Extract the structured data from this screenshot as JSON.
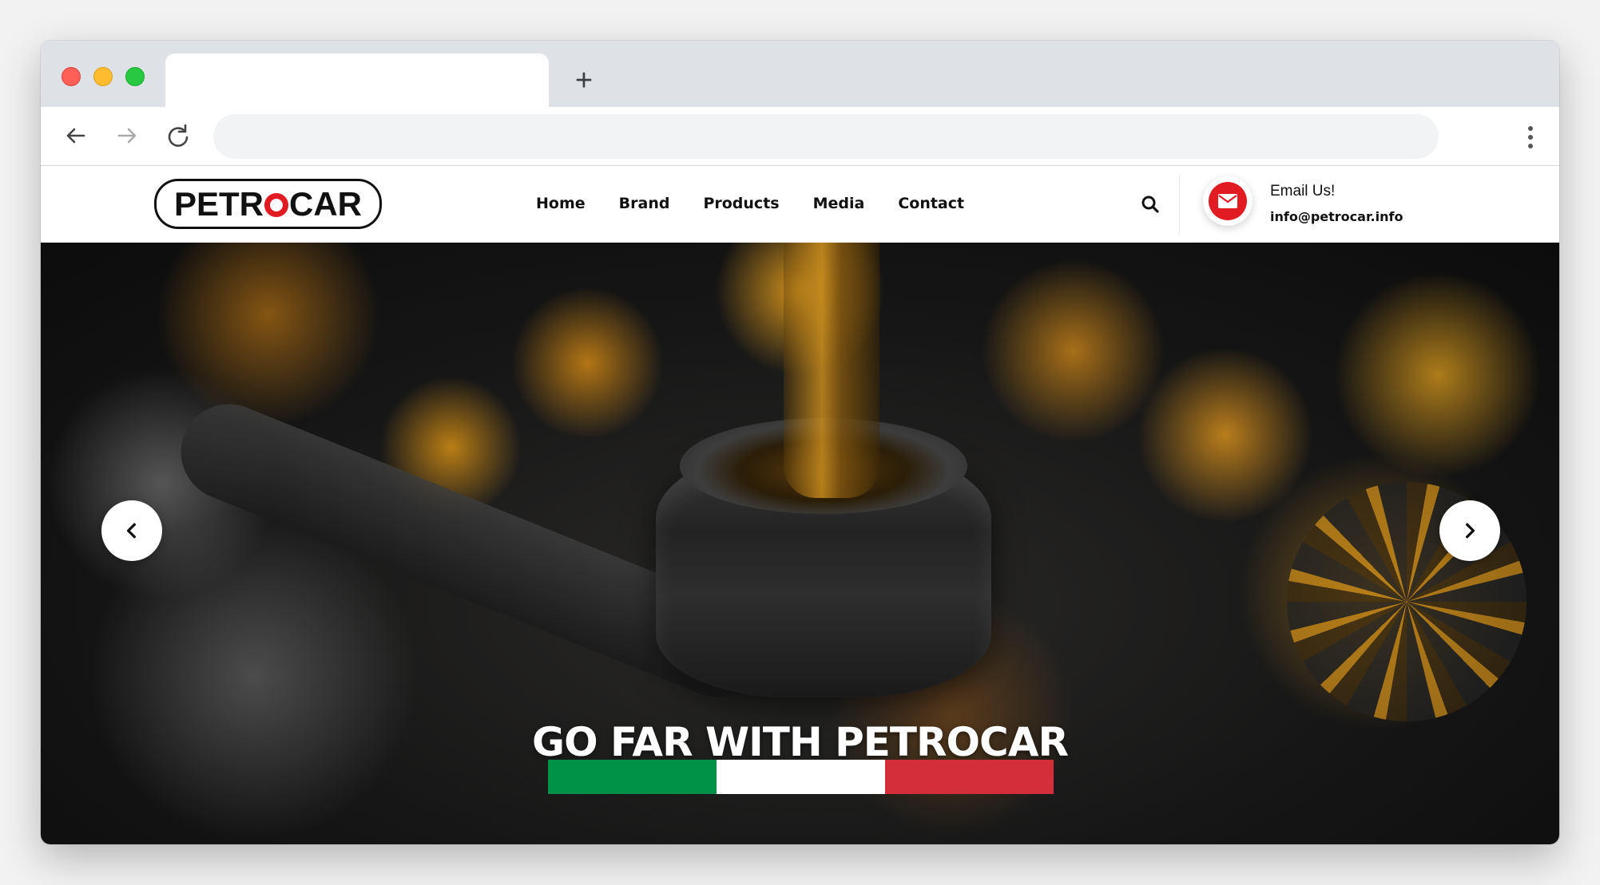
{
  "browser": {
    "tab_title": "",
    "new_tab_label": "+",
    "address_url": ""
  },
  "site": {
    "logo": {
      "left": "PETR",
      "right": "CAR"
    },
    "nav": [
      "Home",
      "Brand",
      "Products",
      "Media",
      "Contact"
    ],
    "email": {
      "label": "Email Us!",
      "address": "info@petrocar.info"
    }
  },
  "hero": {
    "title": "GO FAR WITH PETROCAR",
    "flag_colors": [
      "#009246",
      "#ffffff",
      "#d42e3a"
    ]
  },
  "colors": {
    "accent": "#e21b23",
    "text": "#111111",
    "chrome": "#dee1e6"
  },
  "icons": {
    "back": "arrow-left-icon",
    "forward": "arrow-right-icon",
    "reload": "reload-icon",
    "menu": "kebab-menu-icon",
    "search": "search-icon",
    "email": "envelope-icon",
    "prev": "chevron-left-icon",
    "next": "chevron-right-icon"
  }
}
